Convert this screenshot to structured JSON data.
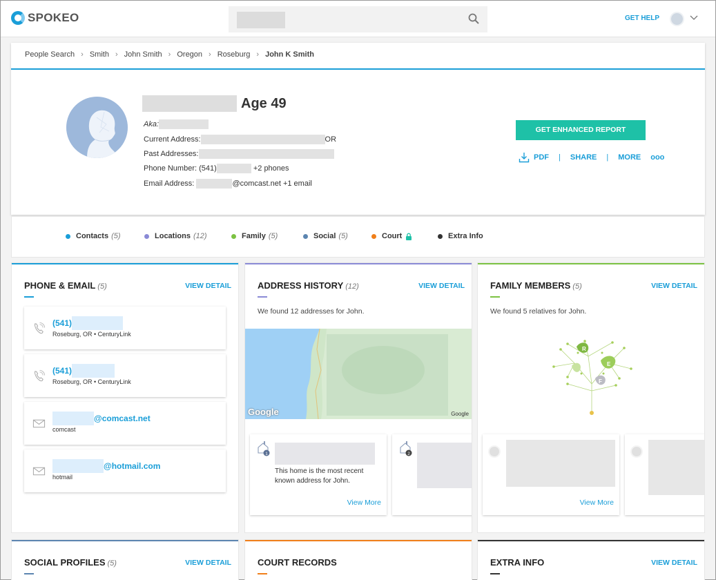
{
  "topbar": {
    "logo_text": "SPOKEO",
    "get_help": "GET HELP",
    "colors": {
      "brand": "#1a9ed8",
      "accent": "#1ec1a7"
    }
  },
  "breadcrumb": {
    "items": [
      "People Search",
      "Smith",
      "John Smith",
      "Oregon",
      "Roseburg"
    ],
    "current": "John K Smith"
  },
  "profile": {
    "age": "Age 49",
    "aka_label": "Aka:",
    "current_address_label": "Current Address:",
    "current_address_state": "OR",
    "past_addresses_label": "Past Addresses:",
    "phone_label": "Phone Number: (541)",
    "phone_more": "+2 phones",
    "email_label": "Email Address:",
    "email_domain": "@comcast.net +1 email",
    "enhanced_button": "GET ENHANCED REPORT",
    "pdf": "PDF",
    "share": "SHARE",
    "more": "MORE",
    "dots": "ooo"
  },
  "tabs": [
    {
      "label": "Contacts",
      "count": "(5)",
      "color": "#1a9ed8"
    },
    {
      "label": "Locations",
      "count": "(12)",
      "color": "#8a8ad6"
    },
    {
      "label": "Family",
      "count": "(5)",
      "color": "#7cc242"
    },
    {
      "label": "Social",
      "count": "(5)",
      "color": "#5c85b0"
    },
    {
      "label": "Court",
      "count": "",
      "color": "#f07f1a"
    },
    {
      "label": "Extra Info",
      "count": "",
      "color": "#333333"
    }
  ],
  "panels": {
    "phone_email": {
      "title": "PHONE & EMAIL",
      "count": "(5)",
      "view_detail": "VIEW DETAIL",
      "items": [
        {
          "value": "(541)",
          "sub": "Roseburg, OR • CenturyLink",
          "icon": "phone-icon"
        },
        {
          "value": "(541)",
          "sub": "Roseburg, OR • CenturyLink",
          "icon": "phone-icon"
        },
        {
          "value": "@comcast.net",
          "sub": "comcast",
          "icon": "mail-icon"
        },
        {
          "value": "@hotmail.com",
          "sub": "hotmail",
          "icon": "mail-icon"
        }
      ]
    },
    "address_history": {
      "title": "ADDRESS HISTORY",
      "count": "(12)",
      "view_detail": "VIEW DETAIL",
      "found": "We found 12 addresses for John.",
      "map_label": "Google",
      "map_small_label": "Google",
      "card_text": "This home is the most recent known address for John.",
      "view_more": "View More",
      "badges": [
        "1",
        "2"
      ]
    },
    "family_members": {
      "title": "FAMILY MEMBERS",
      "count": "(5)",
      "view_detail": "VIEW DETAIL",
      "found": "We found 5 relatives for John.",
      "view_more": "View More",
      "tree_letters": [
        "R",
        "E",
        "F"
      ]
    },
    "social_profiles": {
      "title": "SOCIAL PROFILES",
      "count": "(5)",
      "view_detail": "VIEW DETAIL"
    },
    "court_records": {
      "title": "COURT RECORDS"
    },
    "extra_info": {
      "title": "EXTRA INFO",
      "view_detail": "VIEW DETAIL"
    }
  }
}
